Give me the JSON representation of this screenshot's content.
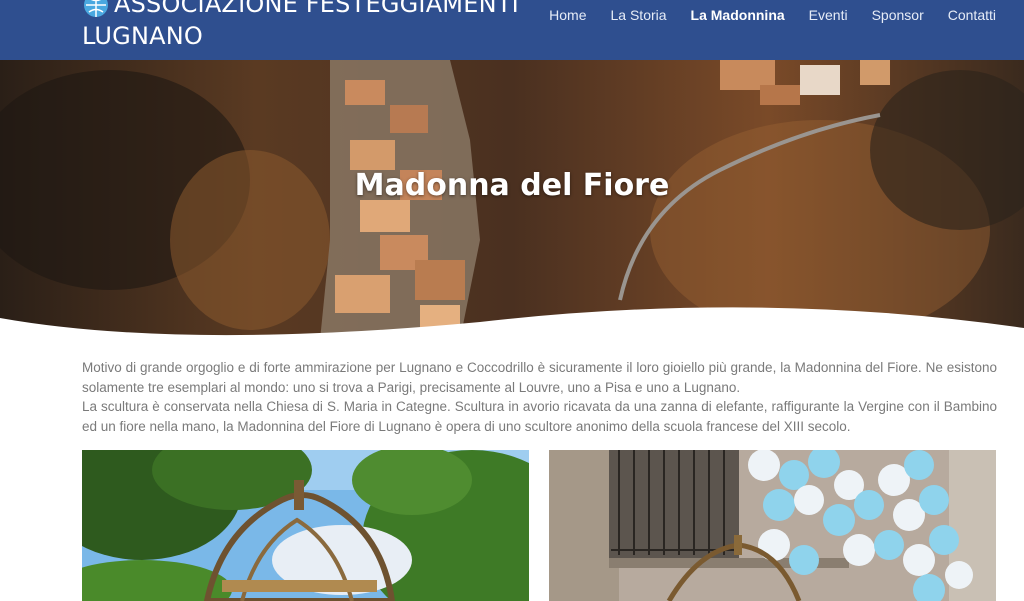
{
  "site": {
    "logo_text_line1": "ASSOCIAZIONE FESTEGGIAMENTI",
    "logo_text_line2": "LUGNANO",
    "logo_icon": "globe-icon"
  },
  "nav": {
    "items": [
      {
        "label": "Home"
      },
      {
        "label": "La Storia"
      },
      {
        "label": "La Madonnina",
        "active": true
      },
      {
        "label": "Eventi"
      },
      {
        "label": "Sponsor"
      },
      {
        "label": "Contatti"
      }
    ]
  },
  "hero": {
    "title": "Madonna del Fiore"
  },
  "content": {
    "paragraph1": "Motivo di grande orgoglio e di forte ammirazione per Lugnano e Coccodrillo è sicuramente il loro gioiello più grande, la Madonnina del Fiore. Ne esistono solamente tre esemplari al mondo: uno si trova a Parigi, precisamente al Louvre, uno a Pisa e uno a Lugnano.",
    "paragraph2": "La scultura è conservata nella Chiesa di S. Maria in Categne. Scultura in avorio ricavata da una zanna di elefante, raffigurante la Vergine con il Bambino ed un fiore nella mano, la Madonnina del Fiore di Lugnano è opera di uno scultore anonimo della scuola francese del XIII secolo."
  },
  "colors": {
    "header_bg": "#2f4f8f",
    "text_gray": "#7a7a7a",
    "balloon_blue": "#8fd3ec"
  }
}
